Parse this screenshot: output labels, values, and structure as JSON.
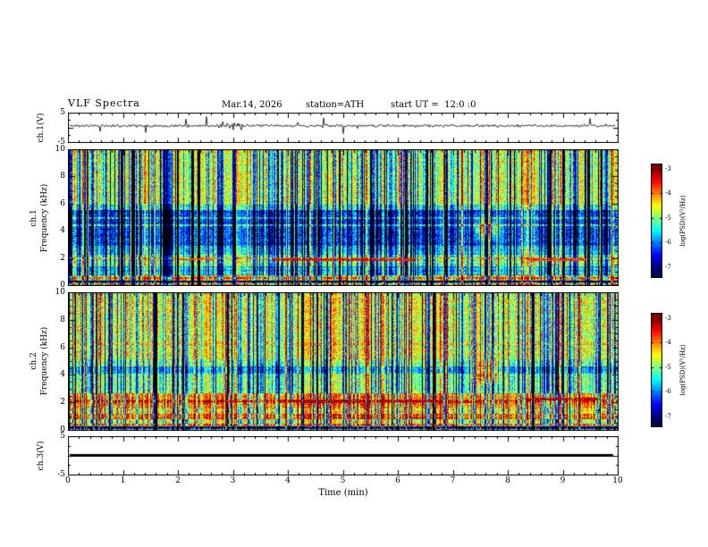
{
  "header": {
    "title": "VLF Spectra",
    "date": "Mar.14, 2026",
    "station": "station=ATH",
    "start_ut": "start UT =  12:0 :0"
  },
  "time_axis": {
    "label": "Time (min)",
    "min": 0,
    "max": 10,
    "major_ticks": [
      0,
      1,
      2,
      3,
      4,
      5,
      6,
      7,
      8,
      9,
      10
    ],
    "minor_tick_step": 0.2
  },
  "colors": {
    "background": "#ffffff",
    "frame": "#000000",
    "trace": "#000000",
    "colormap_note": "jet: dark blue -7 through cyan/green/yellow to dark red -3, black below -7"
  },
  "chart_data": [
    {
      "id": "ch1_waveform",
      "type": "line",
      "ylabel": "ch.1(V)",
      "ylim": [
        -5,
        5
      ],
      "yticks": [
        {
          "label": "5",
          "value": 5
        },
        {
          "label": "-5",
          "value": -5
        }
      ],
      "description": "Broadband noise trace near +0.5 V with frequent impulsive spikes (mostly downward, to about -4 V) and a burst of larger fluctuations near t=3 min; trace spans 0 to ~9.9 min.",
      "signal": {
        "seed": 11,
        "baseline": 0.55,
        "noise_amp": 0.45,
        "spike_rate": 0.02,
        "spike_amp": 2.6,
        "spike_down_fraction": 0.7,
        "burst_t": 2.95,
        "burst_width": 0.22,
        "burst_gain": 2.4,
        "t_end": 9.93
      }
    },
    {
      "id": "ch1_spectrogram",
      "type": "heatmap",
      "ylabel": "ch.1",
      "ylabel2": "Frequency (kHz)",
      "ylim": [
        0,
        10
      ],
      "yticks": [
        {
          "label": "10",
          "value": 10
        },
        {
          "label": "8",
          "value": 8
        },
        {
          "label": "6",
          "value": 6
        },
        {
          "label": "4",
          "value": 4
        },
        {
          "label": "2",
          "value": 2
        },
        {
          "label": "0",
          "value": 0
        }
      ],
      "zlim": [
        -7,
        -3
      ],
      "description": "0-10 kHz spectrogram: green (~-4.8) above 6 kHz, dark blue trough (~-6.2) 3-5.6 kHz, mixed cyan/blue 1-3 kHz, bright line near 0.6 kHz, black band near 0.35 kHz; dense vertical sferic striping; red-brown streak near 2 kHz between ~3.7-6.3 min; green blob at ~7.6 min / 4.1 kHz.",
      "colorbar": {
        "label": "log(PSD)(V²/Hz)",
        "ticks": [
          {
            "label": "-3",
            "value": -3
          },
          {
            "label": "-4",
            "value": -4
          },
          {
            "label": "-5",
            "value": -5
          },
          {
            "label": "-6",
            "value": -6
          },
          {
            "label": "-7",
            "value": -7
          }
        ],
        "vtop": -2.8,
        "vbottom": -7.45
      },
      "render": {
        "seed": 42,
        "noise_amp": 0.6,
        "col_noise": 0.5,
        "row_noise": 0.18,
        "bands": [
          [
            6,
            10,
            -4.75
          ],
          [
            5.6,
            6,
            -5.3
          ],
          [
            3,
            5.6,
            -6.25
          ],
          [
            2.3,
            3,
            -5.7
          ],
          [
            1.5,
            2.3,
            -5.1
          ],
          [
            0.8,
            1.5,
            -5.6
          ],
          [
            0.45,
            0.8,
            -4.4
          ],
          [
            0.3,
            0.45,
            -6.6
          ],
          [
            0.1,
            0.3,
            -5.2
          ],
          [
            0,
            0.1,
            -6.8
          ]
        ],
        "lines": [
          [
            4.5,
            0.15,
            -5.15
          ],
          [
            5.0,
            0.12,
            -5.5
          ],
          [
            2.05,
            0.15,
            -4.35
          ],
          [
            1.8,
            0.12,
            -4.8
          ],
          [
            0.62,
            0.14,
            -3.7
          ],
          [
            0.35,
            0.12,
            -7.4
          ],
          [
            0.18,
            0.12,
            -4.1
          ]
        ],
        "patches": [
          [
            3.7,
            6.3,
            1.95,
            0.2,
            -3.45
          ],
          [
            8.35,
            9.4,
            1.95,
            0.18,
            -3.7
          ],
          [
            2.0,
            2.6,
            2.0,
            0.14,
            -3.8
          ]
        ],
        "blob": {
          "t": 7.6,
          "f": 4.15,
          "st": 0.14,
          "sf": 0.5,
          "amp": 2.0
        },
        "stripes": {
          "dark": 250,
          "dark_depth": 1.6,
          "bright": 130,
          "bright_gain": 0.7
        }
      }
    },
    {
      "id": "ch2_spectrogram",
      "type": "heatmap",
      "ylabel": "ch.2",
      "ylabel2": "Frequency (kHz)",
      "ylim": [
        0,
        10
      ],
      "yticks": [
        {
          "label": "10",
          "value": 10
        },
        {
          "label": "8",
          "value": 8
        },
        {
          "label": "6",
          "value": 6
        },
        {
          "label": "4",
          "value": 4
        },
        {
          "label": "2",
          "value": 2
        },
        {
          "label": "0",
          "value": 0
        }
      ],
      "zlim": [
        -7,
        -3
      ],
      "description": "0-10 kHz spectrogram: green above 5 kHz, narrow dark-blue band ~4.2-4.7 kHz, strong yellow/orange bands 0.9-2.7 kHz with red line ~2.15 kHz and red-brown streaks (3.8-6.7 min, 8.3-9.6 min), bright line ~0.45 kHz, black band ~0.25 kHz; dense vertical striping; yellow-green blob at ~7.6 min / 4.3 kHz.",
      "colorbar": {
        "label": "log(PSD)(V²/Hz)",
        "ticks": [
          {
            "label": "-3",
            "value": -3
          },
          {
            "label": "-4",
            "value": -4
          },
          {
            "label": "-5",
            "value": -5
          },
          {
            "label": "-6",
            "value": -6
          },
          {
            "label": "-7",
            "value": -7
          }
        ],
        "vtop": -2.8,
        "vbottom": -7.45
      },
      "render": {
        "seed": 77,
        "noise_amp": 0.6,
        "col_noise": 0.5,
        "row_noise": 0.18,
        "bands": [
          [
            5.2,
            10,
            -4.65
          ],
          [
            4.7,
            5.2,
            -5.1
          ],
          [
            4.15,
            4.7,
            -5.9
          ],
          [
            2.75,
            4.15,
            -5.05
          ],
          [
            2.3,
            2.75,
            -4.1
          ],
          [
            2.0,
            2.3,
            -3.55
          ],
          [
            1.7,
            2.0,
            -4.0
          ],
          [
            1.25,
            1.7,
            -4.5
          ],
          [
            0.9,
            1.25,
            -3.8
          ],
          [
            0.55,
            0.9,
            -4.7
          ],
          [
            0.35,
            0.55,
            -3.9
          ],
          [
            0.15,
            0.35,
            -6.6
          ],
          [
            0,
            0.15,
            -5.0
          ]
        ],
        "lines": [
          [
            6.3,
            0.12,
            -4.35
          ],
          [
            2.15,
            0.12,
            -3.35
          ],
          [
            0.95,
            0.1,
            -3.6
          ],
          [
            0.45,
            0.1,
            -3.6
          ],
          [
            0.25,
            0.1,
            -7.4
          ]
        ],
        "patches": [
          [
            3.8,
            5.3,
            2.15,
            0.22,
            -3.15
          ],
          [
            5.6,
            6.7,
            2.2,
            0.18,
            -3.25
          ],
          [
            8.3,
            9.6,
            2.3,
            0.2,
            -3.2
          ],
          [
            2.85,
            3.35,
            2.15,
            0.16,
            -3.3
          ],
          [
            6.9,
            7.4,
            2.1,
            0.14,
            -3.35
          ]
        ],
        "blob": {
          "t": 7.6,
          "f": 4.35,
          "st": 0.15,
          "sf": 0.55,
          "amp": 2.4
        },
        "stripes": {
          "dark": 210,
          "dark_depth": 1.5,
          "bright": 140,
          "bright_gain": 0.7
        }
      }
    },
    {
      "id": "ch3_waveform",
      "type": "line",
      "ylabel": "ch.3(V)",
      "ylim": [
        -5,
        5
      ],
      "yticks": [
        {
          "label": "5",
          "value": 5
        },
        {
          "label": "-5",
          "value": -5
        }
      ],
      "description": "Flat thick black line at 0 V spanning 0 to ~9.9 min (channel inactive).",
      "signal": {
        "flat_value": 0,
        "t_end": 9.9,
        "thickness": 3
      }
    }
  ]
}
